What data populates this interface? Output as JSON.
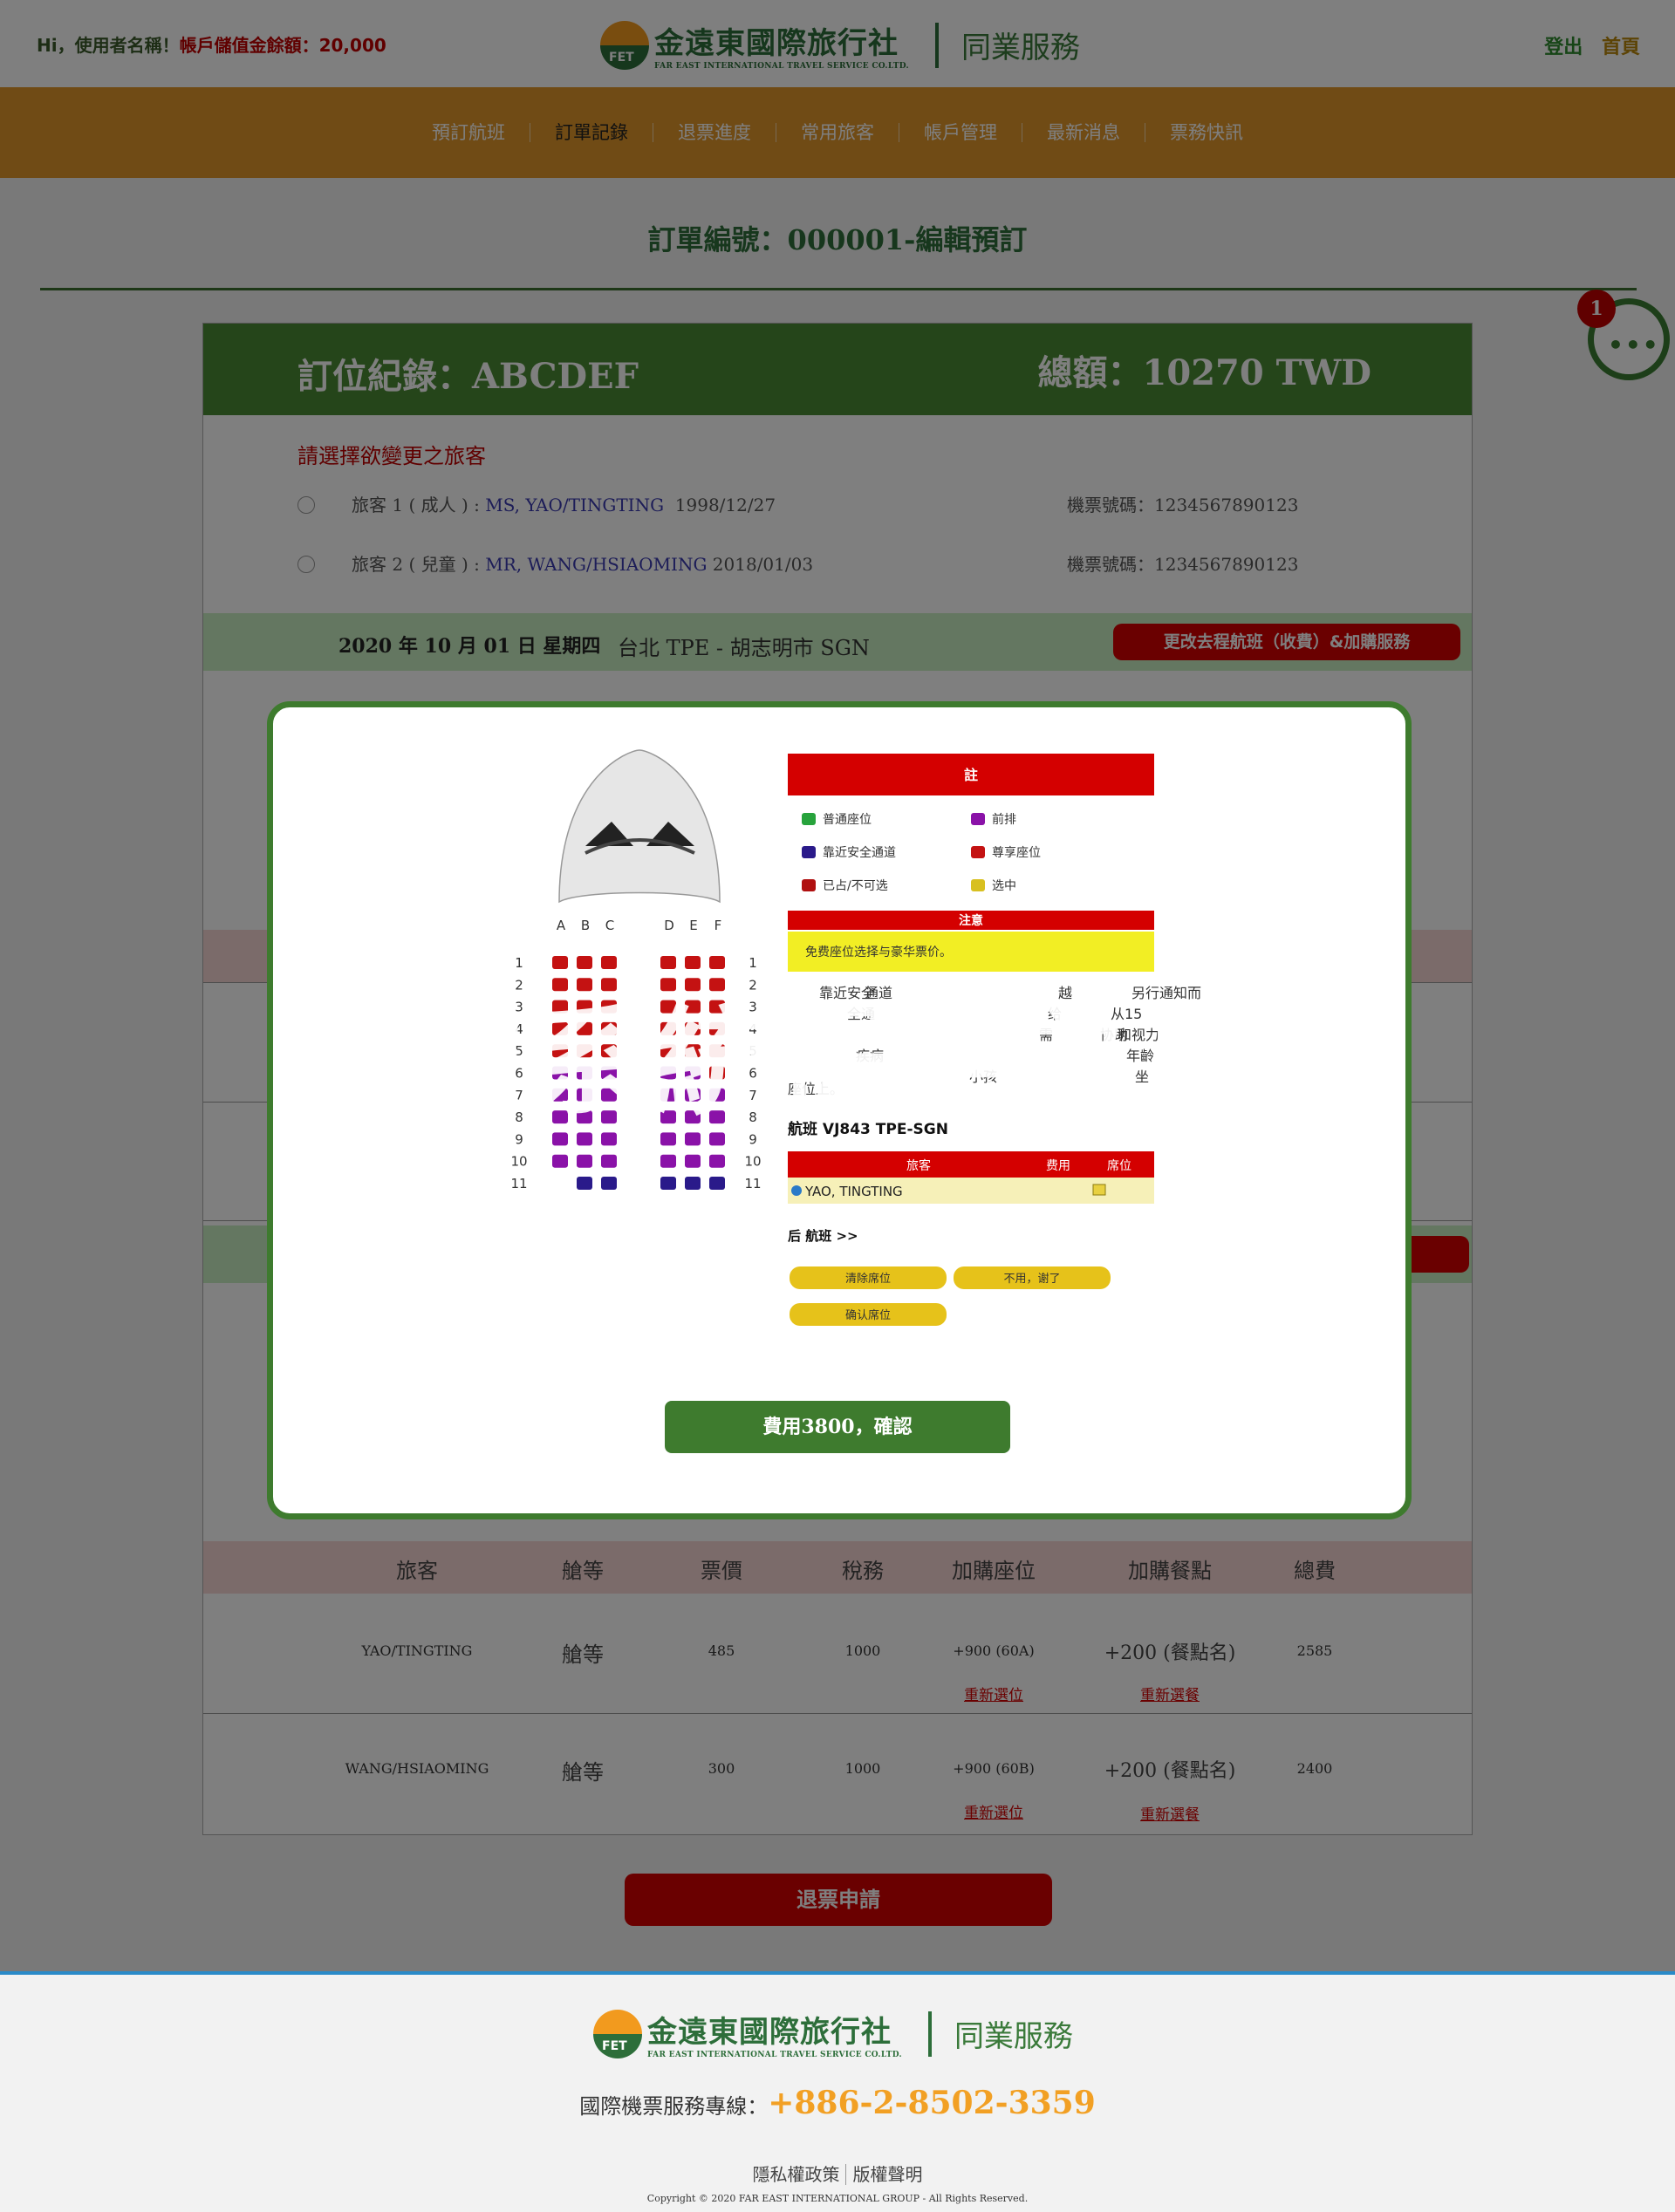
{
  "header": {
    "greeting": "Hi，使用者名稱！",
    "balance": "帳戶儲值金餘額：20,000",
    "logout": "登出",
    "home": "首頁"
  },
  "logo": {
    "zh": "金遠東國際旅行社",
    "en": "FAR EAST INTERNATIONAL TRAVEL SERVICE CO.LTD.",
    "mark": "FET",
    "service": "同業服務"
  },
  "nav": [
    "預訂航班",
    "訂單記錄",
    "退票進度",
    "常用旅客",
    "帳戶管理",
    "最新消息",
    "票務快訊"
  ],
  "nav_active": 1,
  "page_title": "訂單編號：000001-編輯預訂",
  "chat": {
    "badge": "1",
    "icon": "chat-bubble-icon"
  },
  "card": {
    "record": "訂位紀錄：ABCDEF",
    "total": "總額：10270 TWD",
    "select_title": "請選擇欲變更之旅客",
    "passengers": [
      {
        "prefix": "旅客 1 ( 成人 ) : ",
        "name": "MS, YAO/TINGTING",
        "dob": "1998/12/27",
        "ticket": "機票號碼：1234567890123"
      },
      {
        "prefix": "旅客 2 ( 兒童 ) : ",
        "name": "MR, WANG/HSIAOMING",
        "dob": "2018/01/03",
        "ticket": "機票號碼：1234567890123"
      }
    ],
    "flight": {
      "date": "2020 年 10 月 01 日 星期四",
      "route": "台北 TPE - 胡志明市 SGN",
      "change_button": "更改去程航班（收費）&加購服務"
    }
  },
  "price_table": {
    "headers": [
      "旅客",
      "艙等",
      "票價",
      "稅務",
      "加購座位",
      "加購餐點",
      "總費"
    ],
    "rows": [
      {
        "passenger": "YAO/TINGTING",
        "class": "艙等",
        "fare": "485",
        "tax": "1000",
        "seat": "+900 (60A)",
        "seat_link": "重新選位",
        "meal": "+200 (餐點名)",
        "meal_link": "重新選餐",
        "total": "2585"
      },
      {
        "passenger": "WANG/HSIAOMING",
        "class": "艙等",
        "fare": "300",
        "tax": "1000",
        "seat": "+900 (60B)",
        "seat_link": "重新選位",
        "meal": "+200 (餐點名)",
        "meal_link": "重新選餐",
        "total": "2400"
      }
    ]
  },
  "refund_button": "退票申請",
  "modal": {
    "watermark": "依系統提供為主",
    "confirm_button": "費用3800，確認",
    "seatmap": {
      "legend_title": "註",
      "legend": [
        {
          "label": "普通座位",
          "color": "#27a33c"
        },
        {
          "label": "前排",
          "color": "#8a12a8"
        },
        {
          "label": "靠近安全通道",
          "color": "#2a1a8a"
        },
        {
          "label": "尊享座位",
          "color": "#c41212"
        },
        {
          "label": "已占/不可选",
          "color": "#b01010"
        },
        {
          "label": "选中",
          "color": "#d8c020"
        }
      ],
      "notice_title": "注意",
      "notice": "免费座位选择与豪华票价。",
      "rules_fragments": [
        "靠近安全",
        "通道",
        "越",
        "另行通知而",
        "全通",
        "给",
        "从15",
        "需",
        "协助",
        "和视力",
        "疾病",
        "年齡",
        "小孩",
        "坐"
      ],
      "rules_end": "座位上。",
      "flight_label": "航班 VJ843 TPE-SGN",
      "table_headers": [
        "旅客",
        "费用",
        "席位"
      ],
      "table_row": "YAO, TINGTING",
      "next_link": "后 航班 >>",
      "buttons": [
        "清除席位",
        "不用，谢了",
        "确认席位"
      ],
      "columns_left": [
        "A",
        "B",
        "C"
      ],
      "columns_right": [
        "D",
        "E",
        "F"
      ],
      "rows": [
        1,
        2,
        3,
        4,
        5,
        6,
        7,
        8,
        9,
        10,
        11
      ]
    }
  },
  "footer": {
    "hotline_label": "國際機票服務專線：",
    "hotline_number": "+886-2-8502-3359",
    "privacy": "隱私權政策",
    "copyright_link": "版權聲明",
    "copyright": "Copyright © 2020 FAR EAST INTERNATIONAL GROUP - All Rights Reserved."
  }
}
